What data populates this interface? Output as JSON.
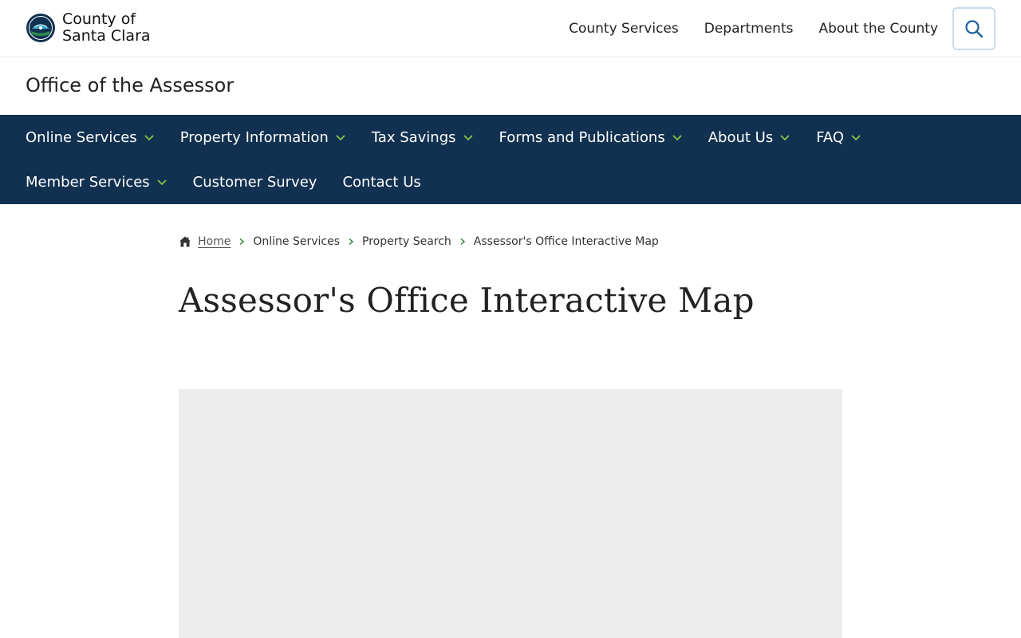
{
  "header": {
    "logo_line1": "County of",
    "logo_line2": "Santa Clara",
    "top_links": [
      "County Services",
      "Departments",
      "About the County"
    ],
    "search_icon": "search-icon"
  },
  "office": {
    "title": "Office of the Assessor"
  },
  "nav": {
    "row1": [
      {
        "label": "Online Services",
        "dropdown": true
      },
      {
        "label": "Property Information",
        "dropdown": true
      },
      {
        "label": "Tax Savings",
        "dropdown": true
      },
      {
        "label": "Forms and Publications",
        "dropdown": true
      },
      {
        "label": "About Us",
        "dropdown": true
      },
      {
        "label": "FAQ",
        "dropdown": true
      }
    ],
    "row2": [
      {
        "label": "Member Services",
        "dropdown": true
      },
      {
        "label": "Customer Survey",
        "dropdown": false
      },
      {
        "label": "Contact Us",
        "dropdown": false
      }
    ]
  },
  "breadcrumb": {
    "home": "Home",
    "items": [
      "Online Services",
      "Property Search",
      "Assessor's Office Interactive Map"
    ]
  },
  "page": {
    "title": "Assessor's Office Interactive Map"
  },
  "colors": {
    "nav_background": "#123150",
    "chevron_accent": "#8bc34a",
    "map_placeholder": "#ededed"
  }
}
